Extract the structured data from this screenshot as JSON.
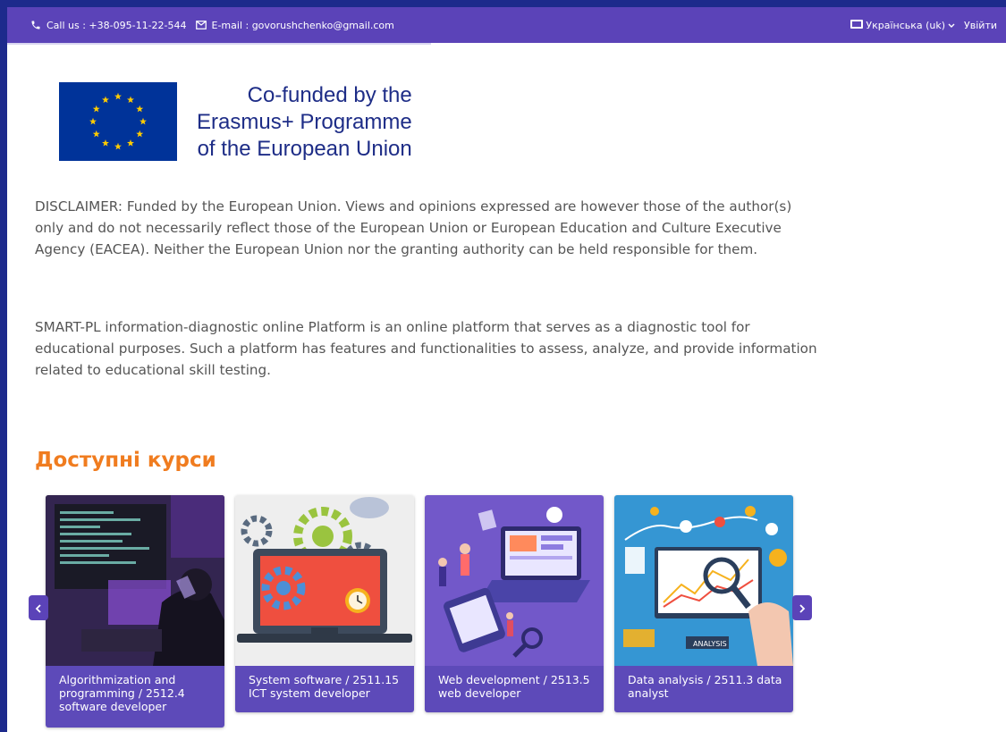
{
  "topbar": {
    "phone": "Call us : +38-095-11-22-544",
    "email": "E-mail : govorushchenko@gmail.com",
    "language": "Українська (uk)",
    "login": "Увійти"
  },
  "eu": {
    "line1": "Co-funded by the",
    "line2": "Erasmus+ Programme",
    "line3": "of the European Union"
  },
  "disclaimer": "DISCLAIMER: Funded by the European Union. Views and opinions expressed are however those of the author(s) only and do not necessarily reflect those of the European Union or European Education and Culture Executive Agency (EACEA). Neither the European Union nor the granting authority can be held responsible for them.",
  "about": "SMART-PL information-diagnostic online Platform is an online platform that serves as a diagnostic tool for educational purposes. Such a platform has features and functionalities to assess, analyze, and provide information related to educational skill testing.",
  "courses": {
    "title": "Доступні курси",
    "items": [
      {
        "label": "Algorithmization and programming / 2512.4 software developer"
      },
      {
        "label": "System software / 2511.15 ICT system developer"
      },
      {
        "label": "Web development / 2513.5 web developer"
      },
      {
        "label": "Data analysis / 2511.3 data analyst"
      }
    ]
  },
  "image_labels": {
    "analysis": "ANALYSIS"
  },
  "colors": {
    "frame": "#1d2a8c",
    "topbar": "#5b43b8",
    "caption": "#5d4ab9",
    "title": "#f07c1f"
  }
}
